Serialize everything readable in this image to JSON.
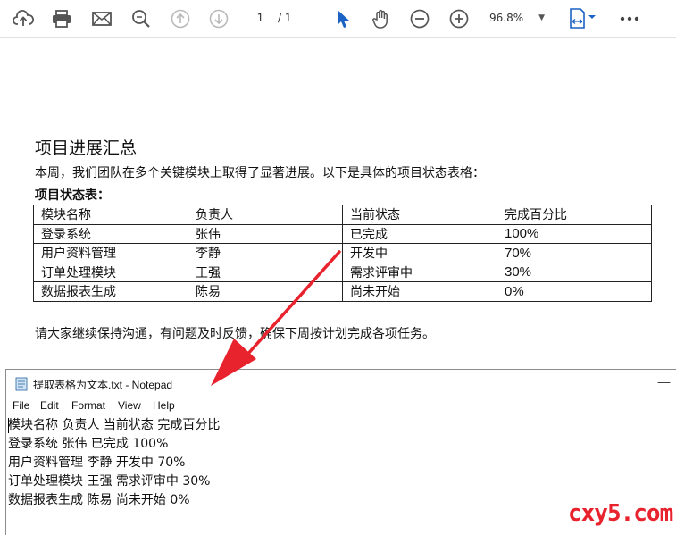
{
  "toolbar": {
    "icons": [
      "cloud-upload-icon",
      "print-icon",
      "mail-icon",
      "zoom-search-icon",
      "page-up-icon",
      "page-down-icon",
      "select-pointer-icon",
      "hand-icon",
      "zoom-out-icon",
      "zoom-in-icon",
      "fit-page-icon",
      "more-icon"
    ],
    "page_current": "1",
    "page_total": "/  1",
    "zoom": "96.8%",
    "accent": "#1a62c4"
  },
  "document": {
    "title": "项目进展汇总",
    "intro": "本周，我们团队在多个关键模块上取得了显著进展。以下是具体的项目状态表格：",
    "table_label": "项目状态表：",
    "table": {
      "headers": [
        "模块名称",
        "负责人",
        "当前状态",
        "完成百分比"
      ],
      "rows": [
        [
          "登录系统",
          "张伟",
          "已完成",
          "100%"
        ],
        [
          "用户资料管理",
          "李静",
          "开发中",
          "70%"
        ],
        [
          "订单处理模块",
          "王强",
          "需求评审中",
          "30%"
        ],
        [
          "数据报表生成",
          "陈易",
          "尚未开始",
          "0%"
        ]
      ]
    },
    "outro": "请大家继续保持沟通，有问题及时反馈，确保下周按计划完成各项任务。"
  },
  "notepad": {
    "title": "提取表格为文本.txt - Notepad",
    "minimize": "—",
    "menu": [
      "File",
      "Edit",
      "Format",
      "View",
      "Help"
    ],
    "lines": [
      "模块名称 负责人 当前状态 完成百分比",
      "登录系统 张伟 已完成 100%",
      "用户资料管理 李静 开发中 70%",
      "订单处理模块 王强 需求评审中 30%",
      "数据报表生成 陈易 尚未开始 0%"
    ]
  },
  "annotation": {
    "arrow_color": "#e8232d"
  },
  "watermark": "cxy5.com"
}
